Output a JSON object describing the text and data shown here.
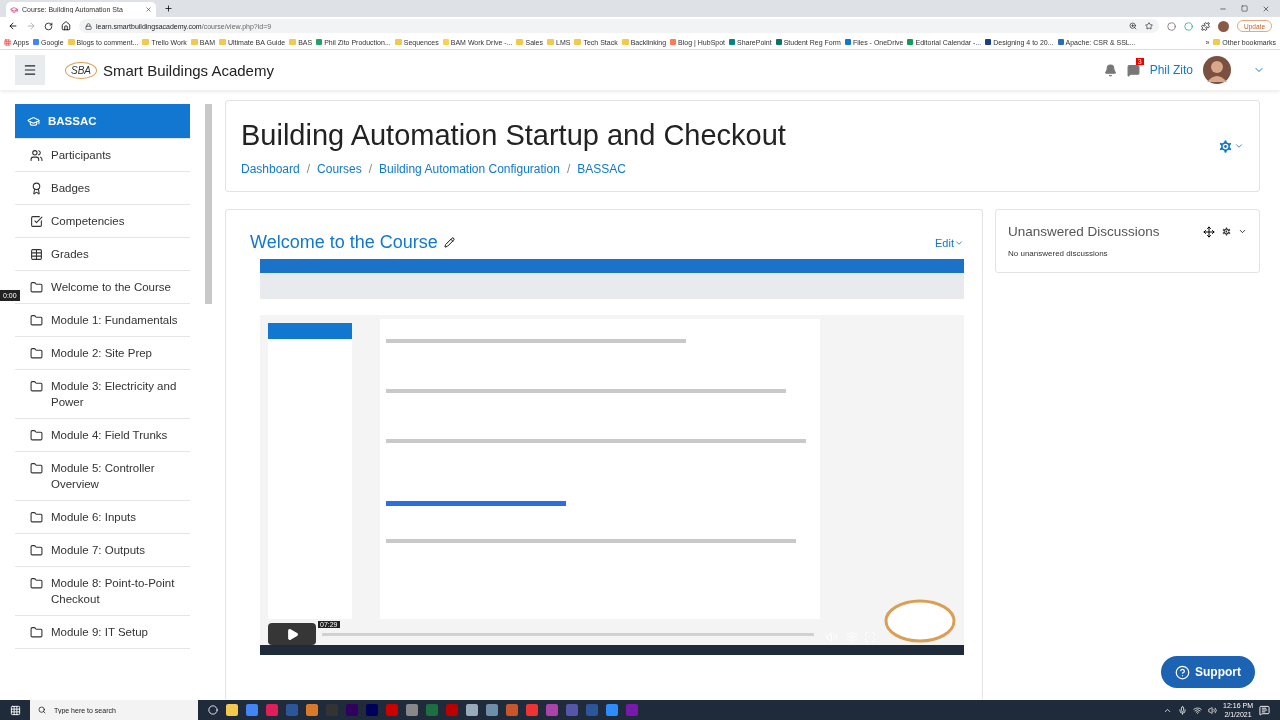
{
  "browser": {
    "tab_title": "Course: Building Automation Sta",
    "url_host": "learn.smartbuildingsacademy.com",
    "url_path": "/course/view.php?id=9",
    "update_label": "Update",
    "bookmarks": [
      {
        "label": "Apps",
        "kind": "apps"
      },
      {
        "label": "Google",
        "kind": "site",
        "color": "#4285f4"
      },
      {
        "label": "Blogs to comment...",
        "kind": "folder"
      },
      {
        "label": "Trello Work",
        "kind": "folder"
      },
      {
        "label": "BAM",
        "kind": "folder"
      },
      {
        "label": "Ultimate BA Guide",
        "kind": "folder"
      },
      {
        "label": "BAS",
        "kind": "folder"
      },
      {
        "label": "Phil Zito Production...",
        "kind": "site",
        "color": "#1fa463"
      },
      {
        "label": "Sequences",
        "kind": "folder"
      },
      {
        "label": "BAM Work Drive -...",
        "kind": "site",
        "color": "#ffd04b"
      },
      {
        "label": "Sales",
        "kind": "folder"
      },
      {
        "label": "LMS",
        "kind": "folder"
      },
      {
        "label": "Tech Stack",
        "kind": "folder"
      },
      {
        "label": "Backlinking",
        "kind": "folder"
      },
      {
        "label": "Blog | HubSpot",
        "kind": "site",
        "color": "#ff7a59"
      },
      {
        "label": "SharePoint",
        "kind": "site",
        "color": "#038387"
      },
      {
        "label": "Student Reg Form",
        "kind": "site",
        "color": "#077568"
      },
      {
        "label": "Files - OneDrive",
        "kind": "site",
        "color": "#0f78d4"
      },
      {
        "label": "Editorial Calendar -...",
        "kind": "site",
        "color": "#0f9d58"
      },
      {
        "label": "Designing 4 to 20...",
        "kind": "site",
        "color": "#1b3d8f"
      },
      {
        "label": "Apache: CSR & SSL...",
        "kind": "site",
        "color": "#2a6fb5"
      }
    ],
    "more_label": "»",
    "other_bookmarks": "Other bookmarks"
  },
  "site": {
    "brand": "Smart Buildings Academy",
    "logo_text": "SBA",
    "user_name": "Phil Zito",
    "message_count": "3"
  },
  "sidebar": {
    "items": [
      {
        "label": "BASSAC",
        "kind": "course",
        "selected": true
      },
      {
        "label": "Participants",
        "kind": "users",
        "selected": false
      },
      {
        "label": "Badges",
        "kind": "badge",
        "selected": false
      },
      {
        "label": "Competencies",
        "kind": "check",
        "selected": false
      },
      {
        "label": "Grades",
        "kind": "table",
        "selected": false
      },
      {
        "label": "Welcome to the Course",
        "kind": "section",
        "selected": false
      },
      {
        "label": "Module 1: Fundamentals",
        "kind": "section",
        "selected": false
      },
      {
        "label": "Module 2: Site Prep",
        "kind": "section",
        "selected": false
      },
      {
        "label": "Module 3: Electricity and Power",
        "kind": "section",
        "selected": false
      },
      {
        "label": "Module 4: Field Trunks",
        "kind": "section",
        "selected": false
      },
      {
        "label": "Module 5: Controller Overview",
        "kind": "section",
        "selected": false
      },
      {
        "label": "Module 6: Inputs",
        "kind": "section",
        "selected": false
      },
      {
        "label": "Module 7: Outputs",
        "kind": "section",
        "selected": false
      },
      {
        "label": "Module 8: Point-to-Point Checkout",
        "kind": "section",
        "selected": false
      },
      {
        "label": "Module 9: IT Setup",
        "kind": "section",
        "selected": false
      }
    ]
  },
  "recorder": {
    "time": "0:00"
  },
  "page": {
    "title": "Building Automation Startup and Checkout",
    "breadcrumb_separator": "/",
    "breadcrumbs": [
      "Dashboard",
      "Courses",
      "Building Automation Configuration",
      "BASSAC"
    ]
  },
  "section": {
    "title": "Welcome to the Course",
    "edit_label": "Edit",
    "video": {
      "kind": "picture",
      "hover_time": "07:29",
      "level": 0.0
    }
  },
  "block": {
    "title": "Unanswered Discussions",
    "text": "No unanswered discussions"
  },
  "support_label": "Support",
  "taskbar": {
    "search_placeholder": "Type here to search",
    "time": "12:16 PM",
    "date": "2/1/2021"
  }
}
